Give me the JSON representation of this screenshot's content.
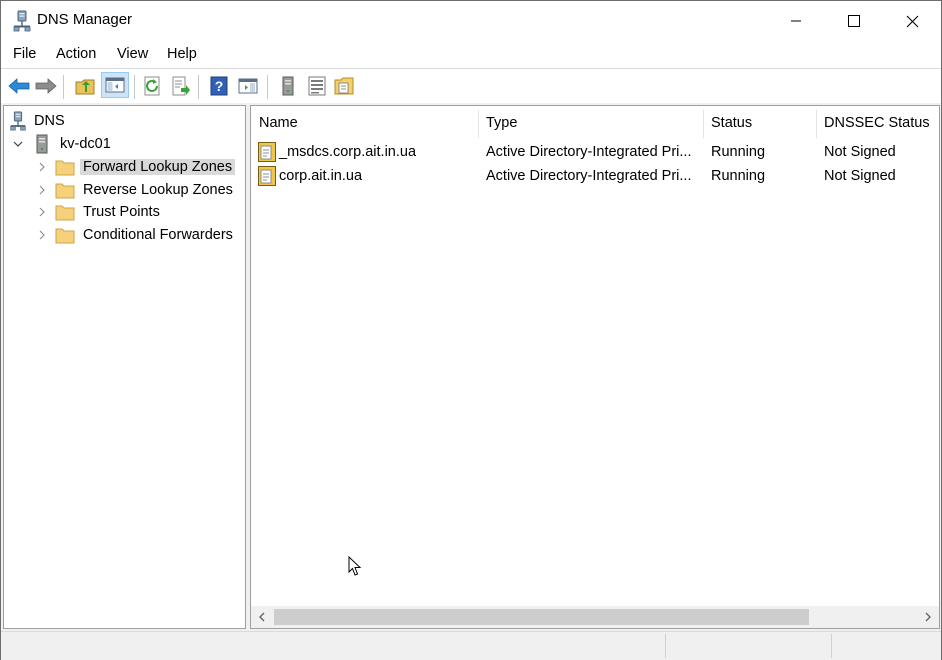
{
  "window": {
    "title": "DNS Manager",
    "icon": "dns-server-icon",
    "controls": [
      "minimize-icon",
      "maximize-icon",
      "close-icon"
    ]
  },
  "menu": {
    "items": [
      "File",
      "Action",
      "View",
      "Help"
    ]
  },
  "toolbar": {
    "buttons": [
      "back-icon",
      "forward-icon",
      "up-folder-icon",
      "show-hide-tree-icon",
      "refresh-icon",
      "export-list-icon",
      "help-icon",
      "show-action-pane-icon",
      "server-icon",
      "list-icon",
      "zone-icon"
    ],
    "pressed": "show-hide-tree-icon"
  },
  "tree": {
    "root": "DNS",
    "server": "kv-dc01",
    "folders": [
      "Forward Lookup Zones",
      "Reverse Lookup Zones",
      "Trust Points",
      "Conditional Forwarders"
    ],
    "selected": "Forward Lookup Zones"
  },
  "list": {
    "columns": [
      "Name",
      "Type",
      "Status",
      "DNSSEC Status"
    ],
    "rows": [
      {
        "name": "_msdcs.corp.ait.in.ua",
        "type": "Active Directory-Integrated Pri...",
        "status": "Running",
        "dnssec": "Not Signed"
      },
      {
        "name": "corp.ait.in.ua",
        "type": "Active Directory-Integrated Pri...",
        "status": "Running",
        "dnssec": "Not Signed"
      }
    ]
  },
  "colors": {
    "selection": "#d9d9d9",
    "toolbar_pressed": "#cce4f7",
    "folder": "#f5d27a",
    "arrow_blue": "#2b8bd8"
  }
}
